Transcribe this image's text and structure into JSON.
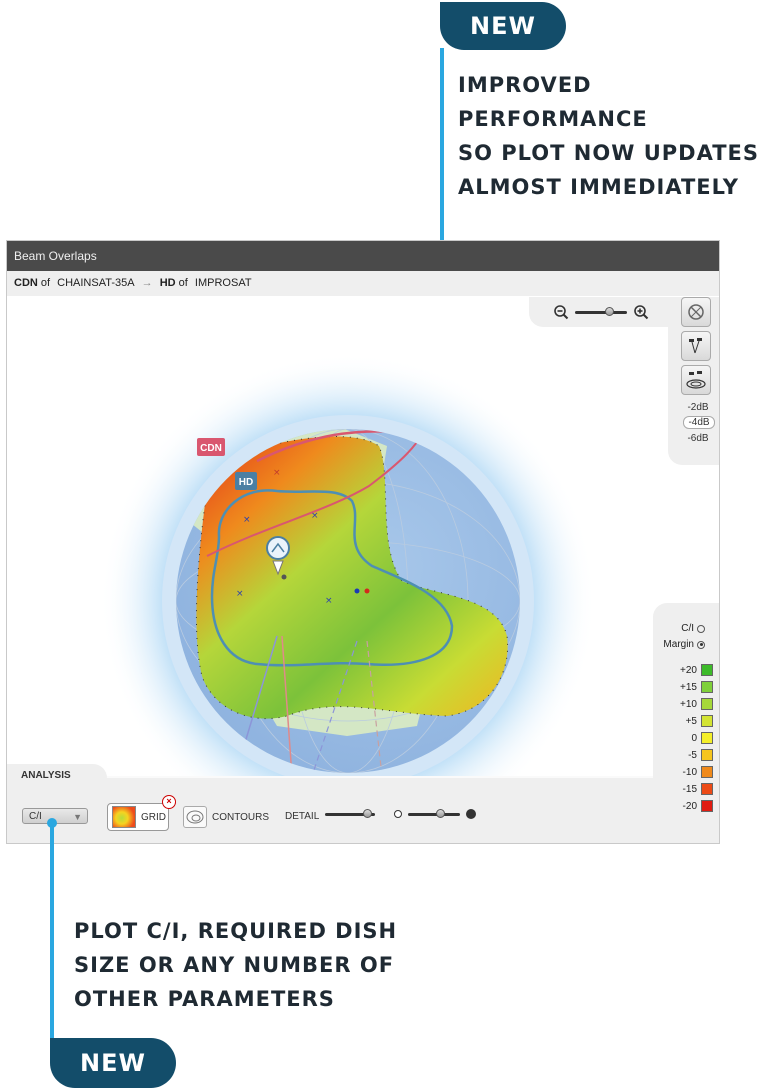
{
  "callouts": {
    "top": {
      "badge": "NEW",
      "lines": [
        "IMPROVED PERFORMANCE",
        "SO PLOT NOW UPDATES",
        "ALMOST IMMEDIATELY"
      ]
    },
    "bottom": {
      "badge": "NEW",
      "lines": [
        "PLOT C/I, REQUIRED DISH",
        "SIZE OR ANY NUMBER OF",
        "OTHER PARAMETERS"
      ]
    },
    "accent_color": "#2aa7e0",
    "badge_color": "#134d6a"
  },
  "window": {
    "title": "Beam Overlaps",
    "subtitle": {
      "from_beam": "CDN",
      "from_of": "of",
      "from_sat": "CHAINSAT-35A",
      "arrow": "→",
      "to_beam": "HD",
      "to_of": "of",
      "to_sat": "IMPROSAT"
    }
  },
  "map": {
    "beam_labels": {
      "cdn": "CDN",
      "hd": "HD"
    },
    "beam_label_colors": {
      "cdn": "#d9576f",
      "hd": "#4b7fa3"
    },
    "zoom_icons": {
      "out": "zoom-out-icon",
      "in": "zoom-in-icon"
    }
  },
  "side_panel": {
    "tools": [
      "no-satellite-icon",
      "satellite-links-icon",
      "satellite-dish-icon"
    ],
    "db_levels": [
      "-2dB",
      "-4dB",
      "-6dB"
    ],
    "db_selected": "-4dB"
  },
  "legend": {
    "options": [
      {
        "label": "C/I",
        "selected": false
      },
      {
        "label": "Margin",
        "selected": true
      }
    ],
    "scale": [
      {
        "label": "+20",
        "color": "#3dbb2a"
      },
      {
        "label": "+15",
        "color": "#7fd03a"
      },
      {
        "label": "+10",
        "color": "#a6d93a"
      },
      {
        "label": "+5",
        "color": "#d3e433"
      },
      {
        "label": "0",
        "color": "#f4ef2a"
      },
      {
        "label": "-5",
        "color": "#f5c51f"
      },
      {
        "label": "-10",
        "color": "#f08a1b"
      },
      {
        "label": "-15",
        "color": "#ec4a16"
      },
      {
        "label": "-20",
        "color": "#e01c12"
      }
    ]
  },
  "analysis": {
    "tab_label": "ANALYSIS",
    "select_value": "C/I",
    "grid_label": "GRID",
    "contours_label": "CONTOURS",
    "detail_label": "DETAIL"
  }
}
